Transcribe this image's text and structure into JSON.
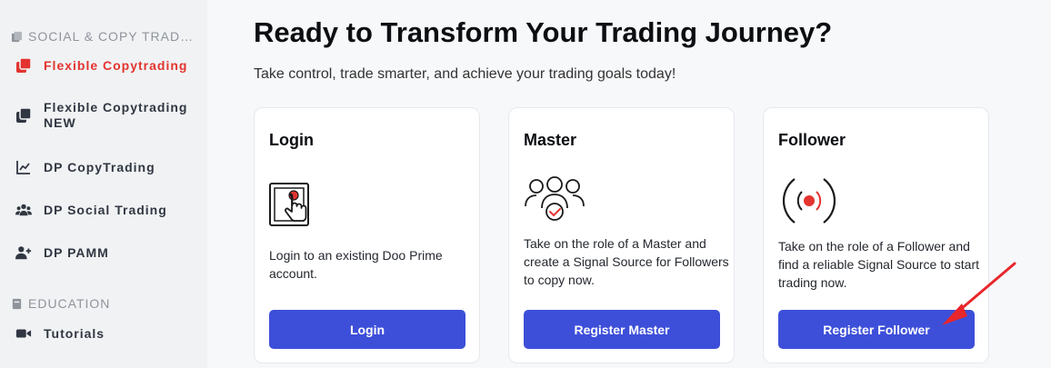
{
  "sidebar": {
    "sections": [
      {
        "title": "SOCIAL & COPY TRAD…",
        "icon": "copy-stack-icon"
      },
      {
        "title": "EDUCATION",
        "icon": "book-icon"
      }
    ],
    "items": [
      {
        "label": "Flexible Copytrading",
        "icon": "copy-stack-icon",
        "active": true
      },
      {
        "label": "Flexible Copytrading",
        "badge": "NEW",
        "icon": "copy-stack-icon"
      },
      {
        "label": "DP CopyTrading",
        "icon": "line-chart-icon"
      },
      {
        "label": "DP Social Trading",
        "icon": "users-icon"
      },
      {
        "label": "DP PAMM",
        "icon": "user-plus-icon"
      },
      {
        "label": "Tutorials",
        "icon": "video-camera-icon"
      }
    ]
  },
  "main": {
    "title": "Ready to Transform Your Trading Journey?",
    "subtitle": "Take control, trade smarter, and achieve your trading goals today!",
    "cards": [
      {
        "title": "Login",
        "icon": "touch-screen-icon",
        "description": "Login to an existing Doo Prime account.",
        "button": "Login"
      },
      {
        "title": "Master",
        "icon": "group-check-icon",
        "description": "Take on the role of a Master and create a Signal Source for Followers to copy now.",
        "button": "Register Master"
      },
      {
        "title": "Follower",
        "icon": "signal-broadcast-icon",
        "description": "Take on the role of a Follower and find a reliable Signal Source to start trading now.",
        "button": "Register Follower"
      }
    ]
  },
  "colors": {
    "accent": "#3d4fd9",
    "active": "#e3342f",
    "annotation_arrow": "#e8262b"
  }
}
